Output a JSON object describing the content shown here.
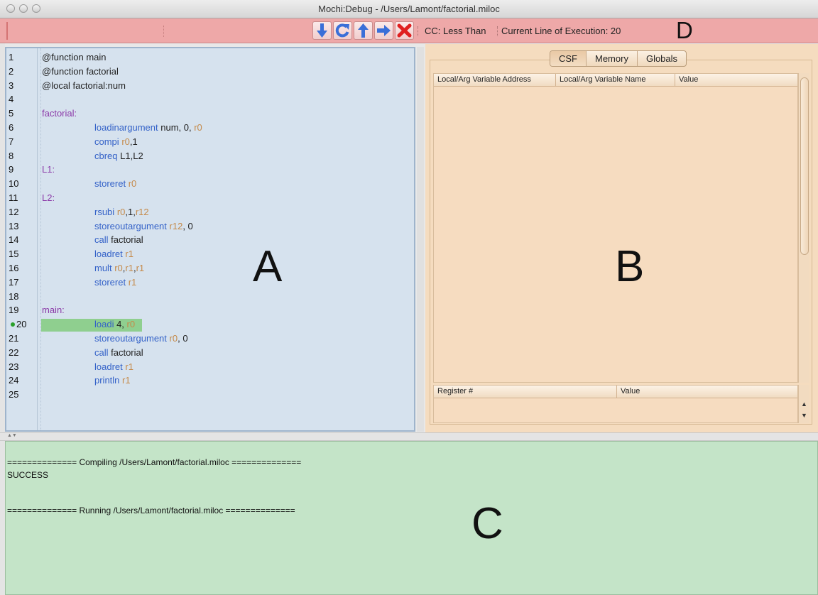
{
  "window": {
    "title": "Mochi:Debug - /Users/Lamont/factorial.miloc"
  },
  "toolbar": {
    "buttons": [
      {
        "name": "step-into",
        "icon": "arrow-down-icon",
        "color": "#3a6fd8"
      },
      {
        "name": "restart",
        "icon": "refresh-icon",
        "color": "#3a6fd8"
      },
      {
        "name": "step-out",
        "icon": "arrow-up-icon",
        "color": "#3a6fd8"
      },
      {
        "name": "step-over",
        "icon": "arrow-right-icon",
        "color": "#3a6fd8"
      },
      {
        "name": "stop",
        "icon": "close-icon",
        "color": "#e02020"
      }
    ],
    "cc_text": "CC: Less Than",
    "line_text": "Current Line of Execution: 20",
    "region_label": "D"
  },
  "editor": {
    "region_label": "A",
    "current_line": 20,
    "lines": [
      {
        "n": "1",
        "text": "@function main"
      },
      {
        "n": "2",
        "text": "@function factorial"
      },
      {
        "n": "3",
        "text": "@local factorial:num"
      },
      {
        "n": "4",
        "text": ""
      },
      {
        "n": "5",
        "text": "factorial:"
      },
      {
        "n": "6",
        "text": "loadinargument num, 0, r0"
      },
      {
        "n": "7",
        "text": "compi r0,1"
      },
      {
        "n": "8",
        "text": "cbreq L1,L2"
      },
      {
        "n": "9",
        "text": "L1:"
      },
      {
        "n": "10",
        "text": "storeret r0"
      },
      {
        "n": "11",
        "text": "L2:"
      },
      {
        "n": "12",
        "text": "rsubi r0,1,r12"
      },
      {
        "n": "13",
        "text": "storeoutargument r12, 0"
      },
      {
        "n": "14",
        "text": "call factorial"
      },
      {
        "n": "15",
        "text": "loadret r1"
      },
      {
        "n": "16",
        "text": "mult r0,r1,r1"
      },
      {
        "n": "17",
        "text": "storeret r1"
      },
      {
        "n": "18",
        "text": ""
      },
      {
        "n": "19",
        "text": "main:"
      },
      {
        "n": "20",
        "text": "loadi 4, r0"
      },
      {
        "n": "21",
        "text": "storeoutargument r0, 0"
      },
      {
        "n": "22",
        "text": "call factorial"
      },
      {
        "n": "23",
        "text": "loadret r1"
      },
      {
        "n": "24",
        "text": "println r1"
      },
      {
        "n": "25",
        "text": ""
      }
    ]
  },
  "inspector": {
    "region_label": "B",
    "tabs": [
      {
        "label": "CSF",
        "active": true
      },
      {
        "label": "Memory",
        "active": false
      },
      {
        "label": "Globals",
        "active": false
      }
    ],
    "variables_table": {
      "columns": [
        "Local/Arg Variable Address",
        "Local/Arg Variable Name",
        "Value"
      ]
    },
    "registers_table": {
      "columns": [
        "Register #",
        "Value"
      ]
    }
  },
  "console": {
    "region_label": "C",
    "lines": [
      "============== Compiling /Users/Lamont/factorial.miloc ==============",
      "SUCCESS",
      "",
      "",
      "============== Running /Users/Lamont/factorial.miloc =============="
    ]
  },
  "colors": {
    "toolbar_bg": "#eea8a8",
    "editor_bg": "#d6e2ee",
    "inspector_bg": "#f5dcbf",
    "console_bg": "#c4e4c8",
    "highlight": "#8fcf8f",
    "label_color": "#8b3aa8",
    "opcode_color": "#3462c8",
    "register_color": "#c58a4a"
  }
}
